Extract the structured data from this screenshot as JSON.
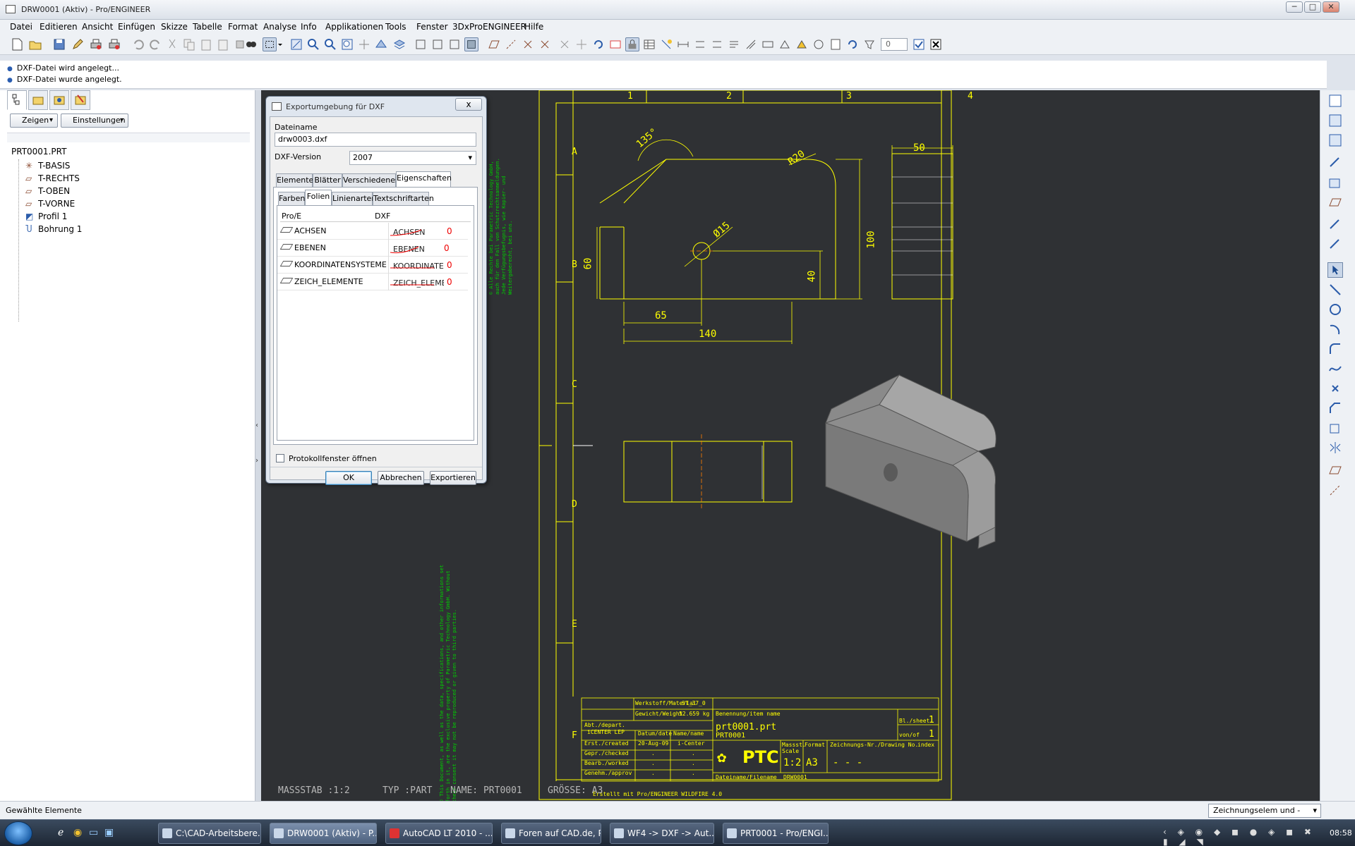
{
  "window": {
    "title": "DRW0001 (Aktiv) - Pro/ENGINEER",
    "minimize": "─",
    "maximize": "□",
    "close": "✕"
  },
  "menu": [
    "Datei",
    "Editieren",
    "Ansicht",
    "Einfügen",
    "Skizze",
    "Tabelle",
    "Format",
    "Analyse",
    "Info",
    "Applikationen",
    "Tools",
    "Fenster",
    "3DxProENGINEER",
    "Hilfe"
  ],
  "toolbar": {
    "spinner_value": "0"
  },
  "messages": [
    "DXF-Datei wird angelegt...",
    "DXF-Datei wurde angelegt."
  ],
  "model_tree": {
    "show_button": "Zeigen",
    "settings_button": "Einstellungen",
    "root": "PRT0001.PRT",
    "items": [
      {
        "label": "T-BASIS",
        "icon": "csys-icon"
      },
      {
        "label": "T-RECHTS",
        "icon": "datum-plane-icon"
      },
      {
        "label": "T-OBEN",
        "icon": "datum-plane-icon"
      },
      {
        "label": "T-VORNE",
        "icon": "datum-plane-icon"
      },
      {
        "label": "Profil 1",
        "icon": "extrude-icon"
      },
      {
        "label": "Bohrung 1",
        "icon": "hole-icon"
      }
    ]
  },
  "dialog": {
    "title": "Exportumgebung für DXF",
    "close": "x",
    "filename_label": "Dateiname",
    "filename_value": "drw0003.dxf",
    "version_label": "DXF-Version",
    "version_value": "2007",
    "tabs": [
      "Elemente",
      "Blätter",
      "Verschiedenes",
      "Eigenschaften"
    ],
    "active_tab": "Eigenschaften",
    "subtabs": [
      "Farben",
      "Folien",
      "Linienarten",
      "Textschriftarten"
    ],
    "active_subtab": "Folien",
    "columns": [
      "Pro/E",
      "DXF"
    ],
    "rows": [
      {
        "proe": "ACHSEN",
        "dxf": "ACHSEN",
        "value": "0"
      },
      {
        "proe": "EBENEN",
        "dxf": "EBENEN",
        "value": "0"
      },
      {
        "proe": "KOORDINATENSYSTEME",
        "dxf": "KOORDINATE",
        "value": "0"
      },
      {
        "proe": "ZEICH_ELEMENTE",
        "dxf": "ZEICH_ELEME",
        "value": "0"
      }
    ],
    "checkbox_label": "Protokollfenster öffnen",
    "ok": "OK",
    "cancel": "Abbrechen",
    "export": "Exportieren"
  },
  "drawing": {
    "colors": {
      "sheet": "#ffff00",
      "dims": "#00e000",
      "background": "#2f3134",
      "model": "#9a9a9a"
    },
    "columns": [
      "1",
      "2",
      "3",
      "4"
    ],
    "rows": [
      "A",
      "B",
      "C",
      "D",
      "E",
      "F"
    ],
    "dims": {
      "angle": "135°",
      "radius": "R20",
      "diameter": "Ø15",
      "d60": "60",
      "d100": "100",
      "d40": "40",
      "d65": "65",
      "d140": "140",
      "d50": "50"
    },
    "notice_top": "© Alle Rechte bei Parametric Technology GmbH, auch für den Fall von Schutzrechtsanmeldungen. Jede Verfügungsbefugnis, wie Kopier- und Weitergaberecht, bei uns.",
    "notice_bottom": "© This Document, as well as the data, specifications, and other informations set forth in it, are the exclusive property of Parametric Technology GmbH. Without their consent it may not be reproduced or given to third parties.",
    "titleblock": {
      "material_label": "Werkstoff/Material",
      "material": "ST_37_0",
      "weight_label": "Gewicht/Weight",
      "weight": "52.659 kg",
      "dept_label": "Abt./depart.",
      "dept": "iCENTER LEP",
      "date_label": "Datum/date",
      "name_label": "Name/name",
      "created_label": "Erst./created",
      "created_date": "20-Aug-09",
      "created_name": "i-Center",
      "checked_label": "Gepr./checked",
      "worked_label": "Bearb./worked",
      "approv_label": "Genehm./approv",
      "empty": ".",
      "item_label": "Benennung/item name",
      "item1": "prt0001.prt",
      "item2": "PRT0001",
      "sheet_label": "Bl./sheet",
      "sheet": "1",
      "of_label": "von/of",
      "of": "1",
      "scale_label": "Massst. Scale",
      "scale": "1:2",
      "format_label": "Format",
      "format": "A3",
      "drawno_label": "Zeichnungs-Nr./Drawing No.",
      "drawno": "- - -",
      "index_label": "index",
      "logo": "PTC",
      "filename_label": "Dateiname/Filename",
      "filename": "DRW0001",
      "created_with": "Erstellt mit Pro/ENGINEER WILDFIRE 4.0"
    },
    "footer": {
      "scale": "MASSSTAB :1:2",
      "type": "TYP :PART",
      "name": "NAME: PRT0001",
      "size": "GRÖSSE: A3"
    }
  },
  "statusbar": {
    "text": "Gewählte Elemente",
    "filter": "Zeichnungselem und -ansicl"
  },
  "taskbar": {
    "buttons": [
      "C:\\CAD-Arbeitsbere...",
      "DRW0001 (Aktiv) - P...",
      "AutoCAD LT 2010 - ...",
      "Foren auf CAD.de, P...",
      "WF4 -> DXF -> Aut...",
      "PRT0001 - Pro/ENGI..."
    ],
    "clock": "08:58"
  }
}
